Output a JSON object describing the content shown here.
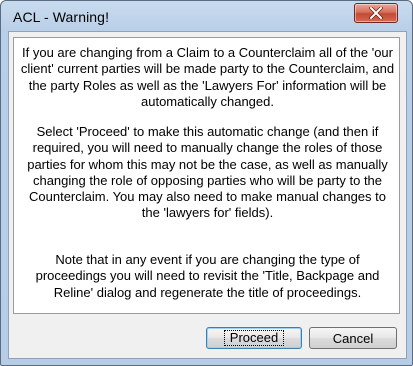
{
  "window": {
    "title": "ACL - Warning!"
  },
  "icons": {
    "close": "close-icon"
  },
  "message": {
    "paragraph1": "If you are changing from a Claim to a Counterclaim all of the 'our client' current parties will be made party to the Counterclaim, and the party Roles as well as the 'Lawyers For' information will be automatically changed.",
    "paragraph2": "Select 'Proceed' to make this automatic change (and then if required, you will need to manually change the roles of those parties for whom this may not be the case, as well as manually changing the role of opposing parties who will be party to the Counterclaim. You may also need to make manual changes to the 'lawyers for' fields).",
    "paragraph3": "Note that in any event if you are changing the type of proceedings you will need to revisit the 'Title, Backpage and Reline' dialog and regenerate the title of proceedings."
  },
  "buttons": {
    "proceed_label": "Proceed",
    "cancel_label": "Cancel"
  }
}
